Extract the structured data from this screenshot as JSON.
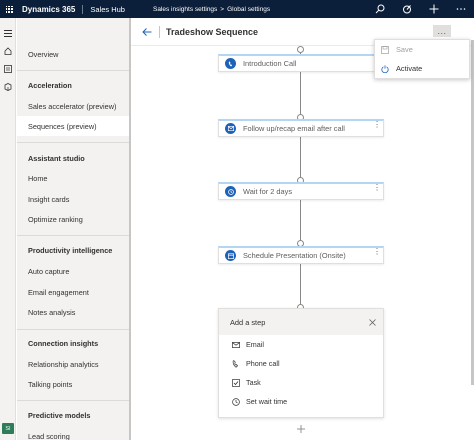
{
  "topbar": {
    "app_name": "Dynamics 365",
    "hub": "Sales Hub",
    "breadcrumbs": [
      "Sales insights settings",
      "Global settings"
    ],
    "breadcrumb_separator": ">",
    "icons": [
      "search-icon",
      "target-icon",
      "add-icon",
      "more-icon"
    ]
  },
  "rail": {
    "icons": [
      "hamburger-icon",
      "home-icon",
      "recent-icon",
      "pinned-icon"
    ],
    "avatar_initials": "SI"
  },
  "sidebar": {
    "overview": "Overview",
    "sections": [
      {
        "heading": "Acceleration",
        "items": [
          "Sales accelerator (preview)",
          "Sequences (preview)"
        ]
      },
      {
        "heading": "Assistant studio",
        "items": [
          "Home",
          "Insight cards",
          "Optimize ranking"
        ]
      },
      {
        "heading": "Productivity intelligence",
        "items": [
          "Auto capture",
          "Email engagement",
          "Notes analysis"
        ]
      },
      {
        "heading": "Connection insights",
        "items": [
          "Relationship analytics",
          "Talking points"
        ]
      },
      {
        "heading": "Predictive models",
        "items": [
          "Lead scoring"
        ]
      }
    ],
    "selected_item": "Sequences (preview)"
  },
  "page": {
    "title": "Tradeshow Sequence",
    "more_label": "..."
  },
  "steps": [
    {
      "label": "Introduction Call",
      "icon": "phone-icon"
    },
    {
      "label": "Follow up/recap email after call",
      "icon": "email-icon"
    },
    {
      "label": "Wait for 2 days",
      "icon": "clock-icon"
    },
    {
      "label": "Schedule Presentation (Onsite)",
      "icon": "task-icon"
    }
  ],
  "add_step": {
    "title": "Add a step",
    "options": [
      {
        "label": "Email",
        "icon": "email-icon"
      },
      {
        "label": "Phone call",
        "icon": "phone-icon"
      },
      {
        "label": "Task",
        "icon": "task-icon"
      },
      {
        "label": "Set wait time",
        "icon": "clock-icon"
      }
    ]
  },
  "menu": {
    "items": [
      {
        "label": "Save",
        "icon": "save-icon",
        "enabled": false
      },
      {
        "label": "Activate",
        "icon": "activate-icon",
        "enabled": true
      }
    ]
  },
  "colors": {
    "topbar": "#0b1f3a",
    "accent": "#1e62b8",
    "sidebar": "#f3f2f1"
  }
}
